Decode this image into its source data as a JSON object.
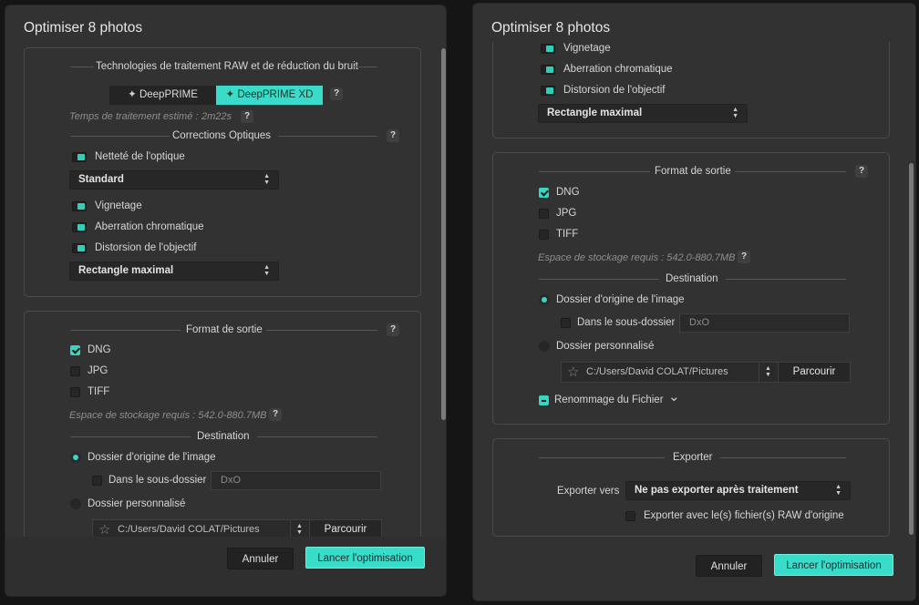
{
  "left": {
    "title": "Optimiser 8 photos",
    "raw_section": {
      "title": "Technologies de traitement RAW et de réduction du bruit",
      "deepprime": "DeepPRIME",
      "deepprime_xd": "DeepPRIME XD",
      "time_label": "Temps de traitement estimé :",
      "time_value": "2m22s"
    },
    "optics": {
      "title": "Corrections Optiques",
      "sharpness": "Netteté de l'optique",
      "sharpness_mode": "Standard",
      "vignetting": "Vignetage",
      "chromatic": "Aberration chromatique",
      "distortion": "Distorsion de l'objectif",
      "crop_mode": "Rectangle maximal"
    },
    "output": {
      "title": "Format de sortie",
      "dng": "DNG",
      "jpg": "JPG",
      "tiff": "TIFF",
      "storage": "Espace de stockage requis : 542.0-880.7MB"
    },
    "destination": {
      "title": "Destination",
      "origin": "Dossier d'origine de l'image",
      "subfolder": "Dans le sous-dossier",
      "subfolder_value": "DxO",
      "custom": "Dossier personnalisé",
      "path": "C:/Users/David COLAT/Pictures",
      "browse": "Parcourir"
    },
    "cancel": "Annuler",
    "launch": "Lancer l'optimisation"
  },
  "right": {
    "title": "Optimiser 8 photos",
    "optics": {
      "vignetting": "Vignetage",
      "chromatic": "Aberration chromatique",
      "distortion": "Distorsion de l'objectif",
      "crop_mode": "Rectangle maximal"
    },
    "output": {
      "title": "Format de sortie",
      "dng": "DNG",
      "jpg": "JPG",
      "tiff": "TIFF",
      "storage": "Espace de stockage requis : 542.0-880.7MB"
    },
    "destination": {
      "title": "Destination",
      "origin": "Dossier d'origine de l'image",
      "subfolder": "Dans le sous-dossier",
      "subfolder_value": "DxO",
      "custom": "Dossier personnalisé",
      "path": "C:/Users/David COLAT/Pictures",
      "browse": "Parcourir",
      "rename": "Renommage du Fichier"
    },
    "export": {
      "title": "Exporter",
      "export_to_label": "Exporter vers",
      "export_to_value": "Ne pas exporter après traitement",
      "with_raw": "Exporter avec le(s) fichier(s) RAW d'origine"
    },
    "cancel": "Annuler",
    "launch": "Lancer l'optimisation"
  },
  "help_mark": "?",
  "colors": {
    "accent": "#38dcc8",
    "bg": "#323232",
    "panel_border": "#4b4b4b"
  }
}
